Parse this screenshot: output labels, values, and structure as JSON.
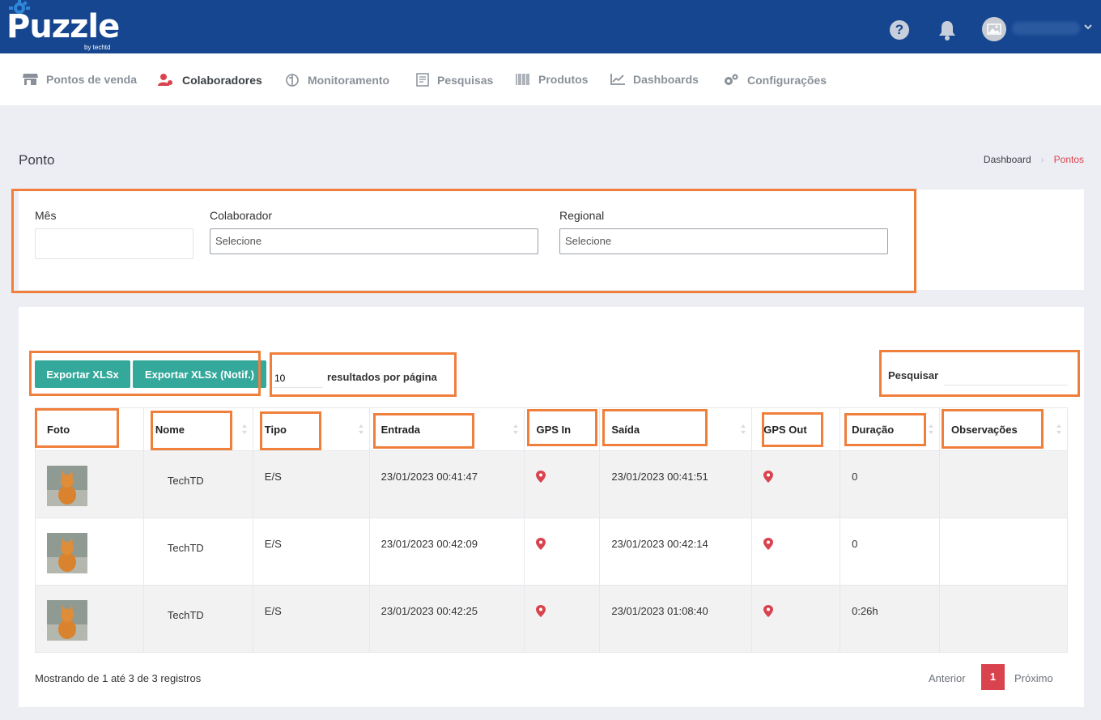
{
  "app": {
    "logo_text": "Puzzle",
    "logo_sub": "by techtd",
    "help_symbol": "?"
  },
  "nav": {
    "items": [
      {
        "label": "Pontos de venda",
        "icon": "store-icon"
      },
      {
        "label": "Colaboradores",
        "icon": "users-icon",
        "active": true
      },
      {
        "label": "Monitoramento",
        "icon": "monitor-icon"
      },
      {
        "label": "Pesquisas",
        "icon": "survey-icon"
      },
      {
        "label": "Produtos",
        "icon": "barcode-icon"
      },
      {
        "label": "Dashboards",
        "icon": "chart-icon"
      },
      {
        "label": "Configurações",
        "icon": "gears-icon"
      }
    ]
  },
  "page": {
    "title": "Ponto",
    "breadcrumb": {
      "home": "Dashboard",
      "current": "Pontos"
    }
  },
  "filters": {
    "month_label": "Mês",
    "month_value": "",
    "collaborator_label": "Colaborador",
    "collaborator_value": "Selecione",
    "regional_label": "Regional",
    "regional_value": "Selecione"
  },
  "toolbar": {
    "export_label": "Exportar XLSx",
    "export_notif_label": "Exportar XLSx (Notif.)",
    "page_length": "10",
    "page_length_label": "resultados por página",
    "search_label": "Pesquisar"
  },
  "table": {
    "headers": [
      "Foto",
      "Nome",
      "Tipo",
      "Entrada",
      "GPS In",
      "Saída",
      "GPS Out",
      "Duração",
      "Observações"
    ],
    "rows": [
      {
        "nome": "TechTD",
        "tipo": "E/S",
        "entrada": "23/01/2023 00:41:47",
        "saida": "23/01/2023 00:41:51",
        "duracao": "0",
        "observacoes": ""
      },
      {
        "nome": "TechTD",
        "tipo": "E/S",
        "entrada": "23/01/2023 00:42:09",
        "saida": "23/01/2023 00:42:14",
        "duracao": "0",
        "observacoes": ""
      },
      {
        "nome": "TechTD",
        "tipo": "E/S",
        "entrada": "23/01/2023 00:42:25",
        "saida": "23/01/2023 01:08:40",
        "duracao": "0:26h",
        "observacoes": ""
      }
    ]
  },
  "footer": {
    "info": "Mostrando de 1 até 3 de 3 registros",
    "prev": "Anterior",
    "page": "1",
    "next": "Próximo"
  },
  "colors": {
    "topbar": "#16468f",
    "accent_red": "#d9434e",
    "button_teal": "#34a89a",
    "annotation_orange": "#f07f3c"
  }
}
